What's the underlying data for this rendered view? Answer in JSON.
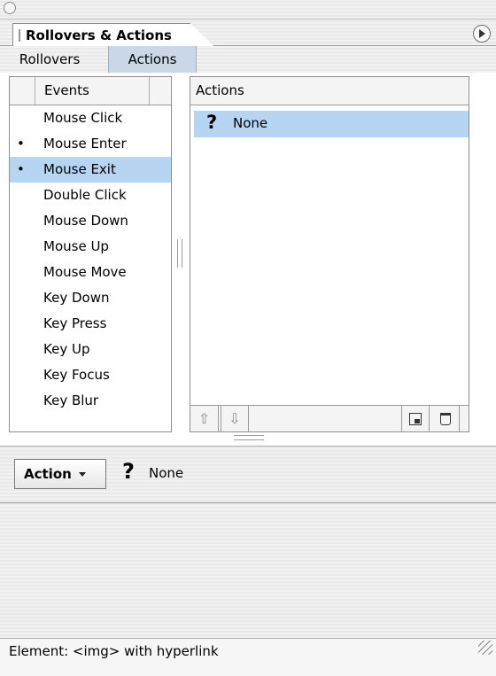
{
  "panel": {
    "title": "Rollovers & Actions"
  },
  "subtabs": [
    "Rollovers",
    "Actions"
  ],
  "events": {
    "header": "Events",
    "items": [
      {
        "label": "Mouse Click",
        "has_action": false,
        "selected": false
      },
      {
        "label": "Mouse Enter",
        "has_action": true,
        "selected": false
      },
      {
        "label": "Mouse Exit",
        "has_action": true,
        "selected": true
      },
      {
        "label": "Double Click",
        "has_action": false,
        "selected": false
      },
      {
        "label": "Mouse Down",
        "has_action": false,
        "selected": false
      },
      {
        "label": "Mouse Up",
        "has_action": false,
        "selected": false
      },
      {
        "label": "Mouse Move",
        "has_action": false,
        "selected": false
      },
      {
        "label": "Key Down",
        "has_action": false,
        "selected": false
      },
      {
        "label": "Key Press",
        "has_action": false,
        "selected": false
      },
      {
        "label": "Key Up",
        "has_action": false,
        "selected": false
      },
      {
        "label": "Key Focus",
        "has_action": false,
        "selected": false
      },
      {
        "label": "Key Blur",
        "has_action": false,
        "selected": false
      }
    ],
    "bullet": "•"
  },
  "actions": {
    "header": "Actions",
    "rows": [
      {
        "icon": "?",
        "label": "None"
      }
    ],
    "toolbar": {
      "up_glyph": "⇧",
      "down_glyph": "⇩"
    }
  },
  "action_bar": {
    "dropdown_label": "Action",
    "icon": "?",
    "value": "None"
  },
  "status": {
    "text": "Element: <img> with hyperlink"
  },
  "colors": {
    "selection": "#b5d5f3",
    "active_subtab": "#c9d7e6"
  }
}
